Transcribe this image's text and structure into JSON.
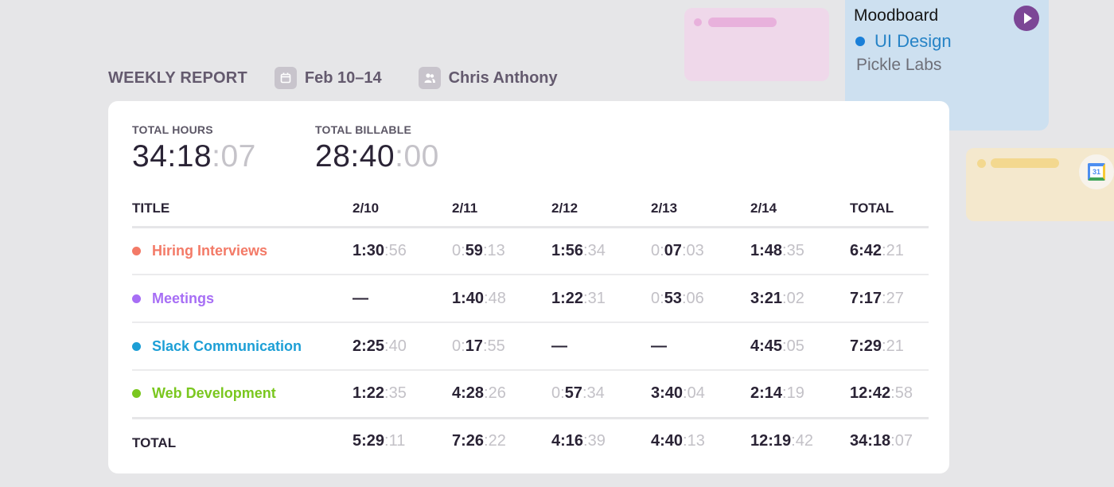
{
  "header": {
    "title": "WEEKLY REPORT",
    "date_range": "Feb 10–14",
    "date_icon": "calendar-icon",
    "user": "Chris Anthony",
    "user_icon": "users-icon"
  },
  "stats": {
    "total_hours": {
      "label": "TOTAL HOURS",
      "hm": "34:18",
      "sec": ":07"
    },
    "total_billable": {
      "label": "TOTAL BILLABLE",
      "hm": "28:40",
      "sec": ":00"
    }
  },
  "table": {
    "columns": [
      "TITLE",
      "2/10",
      "2/11",
      "2/12",
      "2/13",
      "2/14",
      "TOTAL"
    ],
    "rows": [
      {
        "title": "Hiring Interviews",
        "color": "#f37a67",
        "cells": [
          "1:30:56",
          "0:59:13",
          "1:56:34",
          "0:07:03",
          "1:48:35",
          "6:42:21"
        ]
      },
      {
        "title": "Meetings",
        "color": "#a76ef5",
        "cells": [
          "—",
          "1:40:48",
          "1:22:31",
          "0:53:06",
          "3:21:02",
          "7:17:27"
        ]
      },
      {
        "title": "Slack Communication",
        "color": "#1d9fd6",
        "cells": [
          "2:25:40",
          "0:17:55",
          "—",
          "—",
          "4:45:05",
          "7:29:21"
        ]
      },
      {
        "title": "Web Development",
        "color": "#7ac71f",
        "cells": [
          "1:22:35",
          "4:28:26",
          "0:57:34",
          "3:40:04",
          "2:14:19",
          "12:42:58"
        ]
      }
    ],
    "footer": {
      "label": "TOTAL",
      "cells": [
        "5:29:11",
        "7:26:22",
        "4:16:39",
        "4:40:13",
        "12:19:42",
        "34:18:07"
      ]
    }
  },
  "side_cards": {
    "moodboard": {
      "title": "Moodboard",
      "project": "UI Design",
      "project_color": "#1a7fd8",
      "client": "Pickle Labs",
      "play_icon": "play-icon",
      "play_color": "#7c4696"
    },
    "calendar_icon_label": "31"
  }
}
